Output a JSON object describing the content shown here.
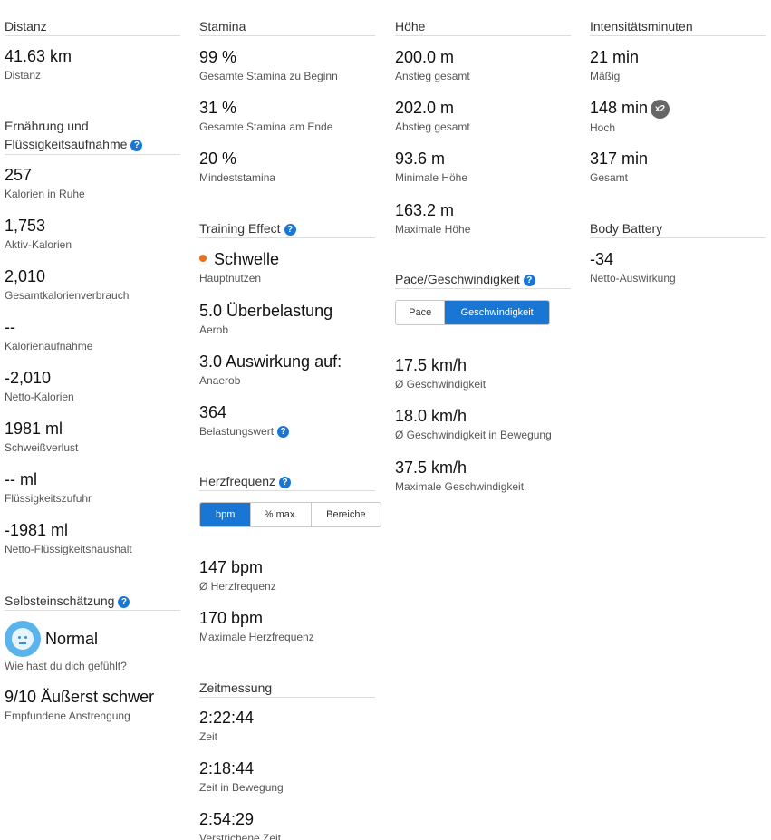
{
  "distance": {
    "header": "Distanz",
    "items": [
      {
        "value": "41.63 km",
        "label": "Distanz"
      }
    ]
  },
  "nutrition": {
    "header_line1": "Ernährung und",
    "header_line2": "Flüssigkeitsaufnahme",
    "items": [
      {
        "value": "257",
        "label": "Kalorien in Ruhe"
      },
      {
        "value": "1,753",
        "label": "Aktiv-Kalorien"
      },
      {
        "value": "2,010",
        "label": "Gesamtkalorienverbrauch"
      },
      {
        "value": "--",
        "label": "Kalorienaufnahme"
      },
      {
        "value": "-2,010",
        "label": "Netto-Kalorien"
      },
      {
        "value": "1981 ml",
        "label": "Schweißverlust"
      },
      {
        "value": "-- ml",
        "label": "Flüssigkeitszufuhr"
      },
      {
        "value": "-1981 ml",
        "label": "Netto-Flüssigkeitshaushalt"
      }
    ]
  },
  "self_assessment": {
    "header": "Selbsteinschätzung",
    "mood_value": "Normal",
    "mood_label": "Wie hast du dich gefühlt?",
    "effort_value": "9/10 Äußerst schwer",
    "effort_label": "Empfundene Anstrengung"
  },
  "stamina": {
    "header": "Stamina",
    "items": [
      {
        "value": "99 %",
        "label": "Gesamte Stamina zu Beginn"
      },
      {
        "value": "31 %",
        "label": "Gesamte Stamina am Ende"
      },
      {
        "value": "20 %",
        "label": "Mindeststamina"
      }
    ]
  },
  "training_effect": {
    "header": "Training Effect",
    "items": [
      {
        "value": "Schwelle",
        "label": "Hauptnutzen"
      },
      {
        "value": "5.0 Überbelastung",
        "label": "Aerob"
      },
      {
        "value": "3.0 Auswirkung auf:",
        "label": "Anaerob"
      },
      {
        "value": "364",
        "label": "Belastungswert"
      }
    ],
    "primary_color": "#e8711a"
  },
  "heart_rate": {
    "header": "Herzfrequenz",
    "tabs": [
      "bpm",
      "% max.",
      "Bereiche"
    ],
    "active_tab": "bpm",
    "items": [
      {
        "value": "147 bpm",
        "label": "Ø Herzfrequenz"
      },
      {
        "value": "170 bpm",
        "label": "Maximale Herzfrequenz"
      }
    ]
  },
  "timing": {
    "header": "Zeitmessung",
    "items": [
      {
        "value": "2:22:44",
        "label": "Zeit"
      },
      {
        "value": "2:18:44",
        "label": "Zeit in Bewegung"
      },
      {
        "value": "2:54:29",
        "label": "Verstrichene Zeit"
      }
    ]
  },
  "elevation": {
    "header": "Höhe",
    "items": [
      {
        "value": "200.0 m",
        "label": "Anstieg gesamt"
      },
      {
        "value": "202.0 m",
        "label": "Abstieg gesamt"
      },
      {
        "value": "93.6 m",
        "label": "Minimale Höhe"
      },
      {
        "value": "163.2 m",
        "label": "Maximale Höhe"
      }
    ]
  },
  "pace": {
    "header": "Pace/Geschwindigkeit",
    "tabs": [
      "Pace",
      "Geschwindigkeit"
    ],
    "active_tab": "Geschwindigkeit",
    "items": [
      {
        "value": "17.5 km/h",
        "label": "Ø Geschwindigkeit"
      },
      {
        "value": "18.0 km/h",
        "label": "Ø Geschwindigkeit in Bewegung"
      },
      {
        "value": "37.5 km/h",
        "label": "Maximale Geschwindigkeit"
      }
    ]
  },
  "intensity": {
    "header": "Intensitätsminuten",
    "items": [
      {
        "value": "21 min",
        "label": "Mäßig"
      },
      {
        "value": "148 min",
        "label": "Hoch",
        "badge": "x2"
      },
      {
        "value": "317 min",
        "label": "Gesamt"
      }
    ]
  },
  "body_battery": {
    "header": "Body Battery",
    "items": [
      {
        "value": "-34",
        "label": "Netto-Auswirkung"
      }
    ]
  },
  "help_glyph": "?",
  "accent_color": "#1976d2"
}
